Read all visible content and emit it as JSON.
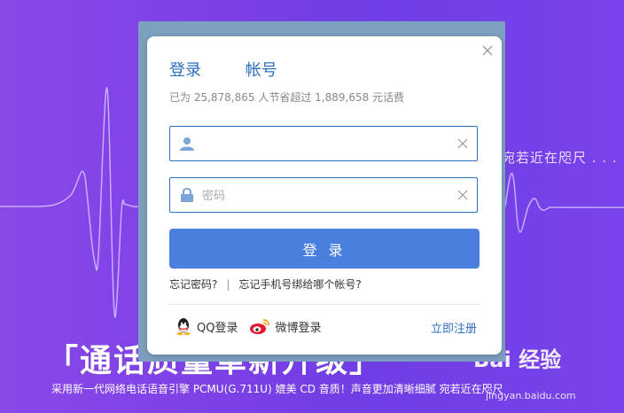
{
  "background": {
    "tagline": "宛若近在咫尺 . . .",
    "headline": "「通话质量革新升级」",
    "subline": "采用新一代网络电话语音引擎 PCMU(G.711U)  媲美 CD 音质！声音更加清晰细腻 宛若近在咫尺",
    "watermark": "Bai 经验",
    "watermark_sub": "jingyan.baidu.com"
  },
  "dialog": {
    "tab_login": "登录",
    "tab_account": "帐号",
    "stats_text": "已为 25,878,865 人节省超过 1,889,658 元话费",
    "username": {
      "value": "",
      "placeholder": ""
    },
    "password": {
      "value": "",
      "placeholder": "密码"
    },
    "login_button": "登 录",
    "forgot_password": "忘记密码?",
    "separator": "|",
    "forgot_account": "忘记手机号绑给哪个帐号?",
    "qq_login": "QQ登录",
    "weibo_login": "微博登录",
    "register": "立即注册"
  },
  "colors": {
    "accent": "#4a7fe0",
    "link": "#2f6fbf",
    "background": "#7a3fe6"
  },
  "icons": [
    "close-icon",
    "user-icon",
    "lock-icon",
    "clear-icon",
    "qq-icon",
    "weibo-icon"
  ]
}
